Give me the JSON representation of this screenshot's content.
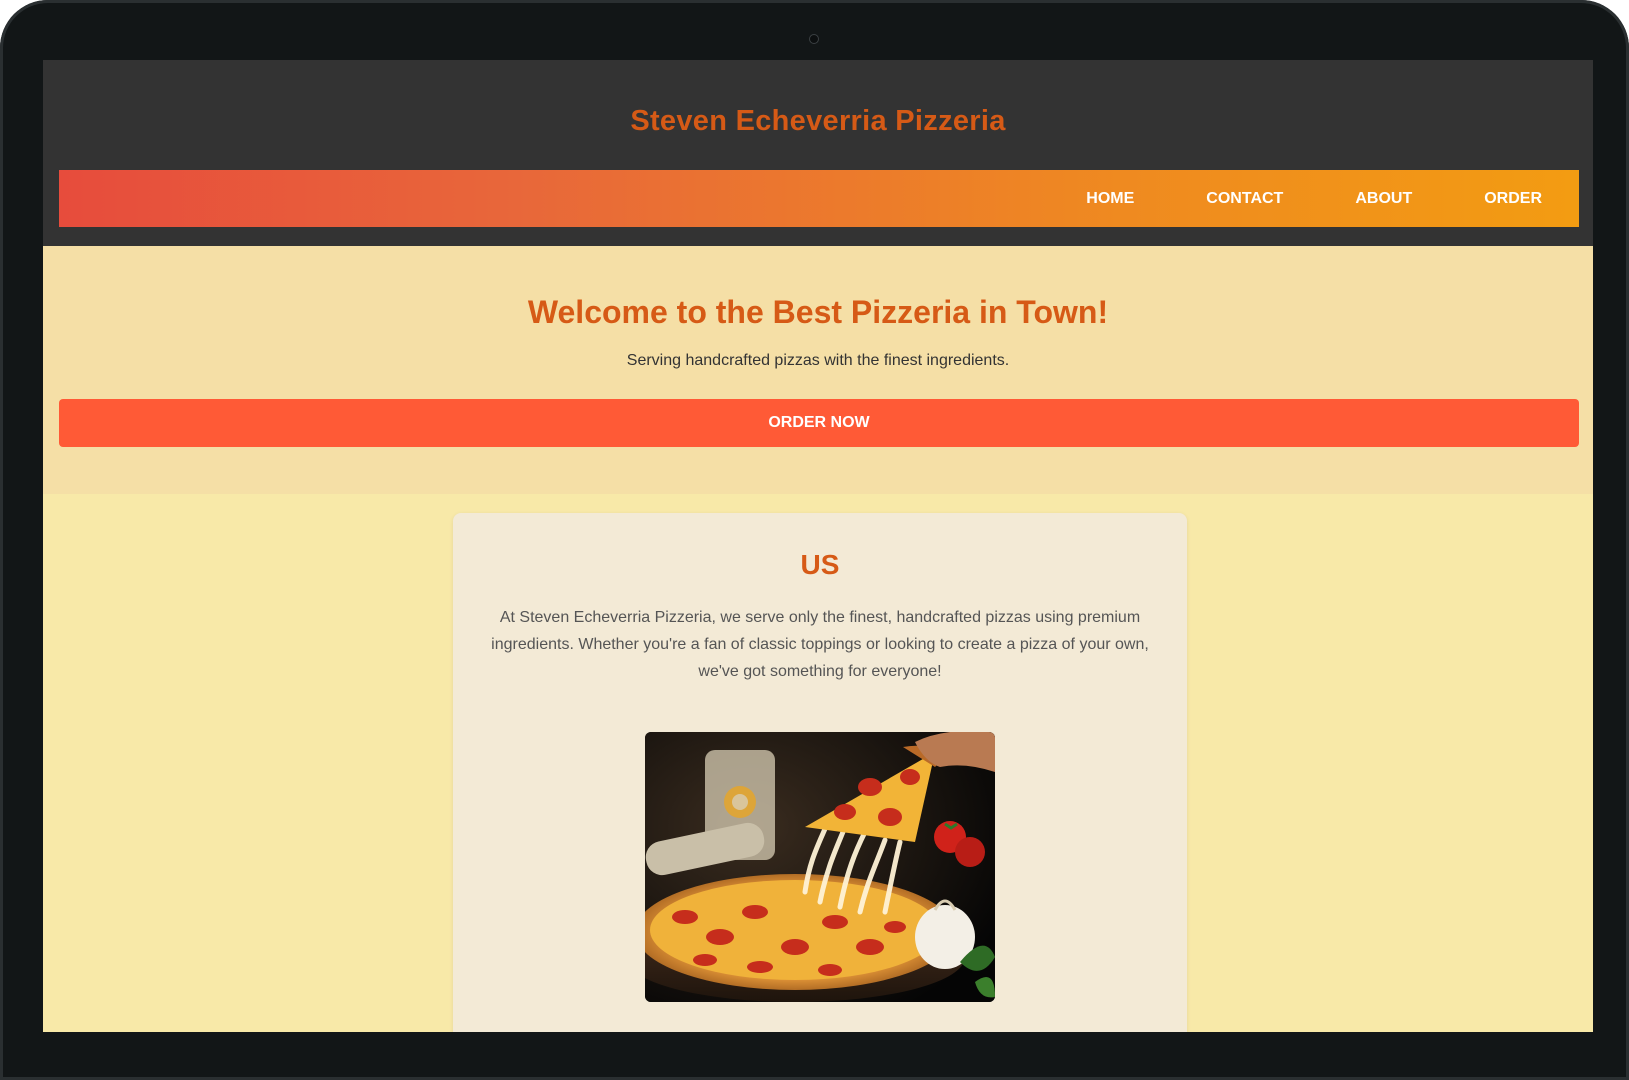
{
  "site": {
    "title": "Steven Echeverria Pizzeria"
  },
  "nav": {
    "items": [
      {
        "label": "HOME"
      },
      {
        "label": "CONTACT"
      },
      {
        "label": "ABOUT"
      },
      {
        "label": "ORDER"
      }
    ]
  },
  "hero": {
    "title": "Welcome to the Best Pizzeria in Town!",
    "subtitle": "Serving handcrafted pizzas with the finest ingredients.",
    "cta_label": "ORDER NOW"
  },
  "about": {
    "title": "US",
    "text": "At Steven Echeverria Pizzeria, we serve only the finest, handcrafted pizzas using premium ingredients. Whether you're a fan of classic toppings or looking to create a pizza of your own, we've got something for everyone!"
  },
  "colors": {
    "accent": "#d65a16",
    "header_bg": "#333333",
    "nav_gradient_start": "#e74c3c",
    "nav_gradient_end": "#f39c12",
    "hero_bg": "#f5dfa6",
    "cta": "#ff5a36",
    "page_bg": "#f8e9a8",
    "card_bg": "#f3ead6"
  }
}
